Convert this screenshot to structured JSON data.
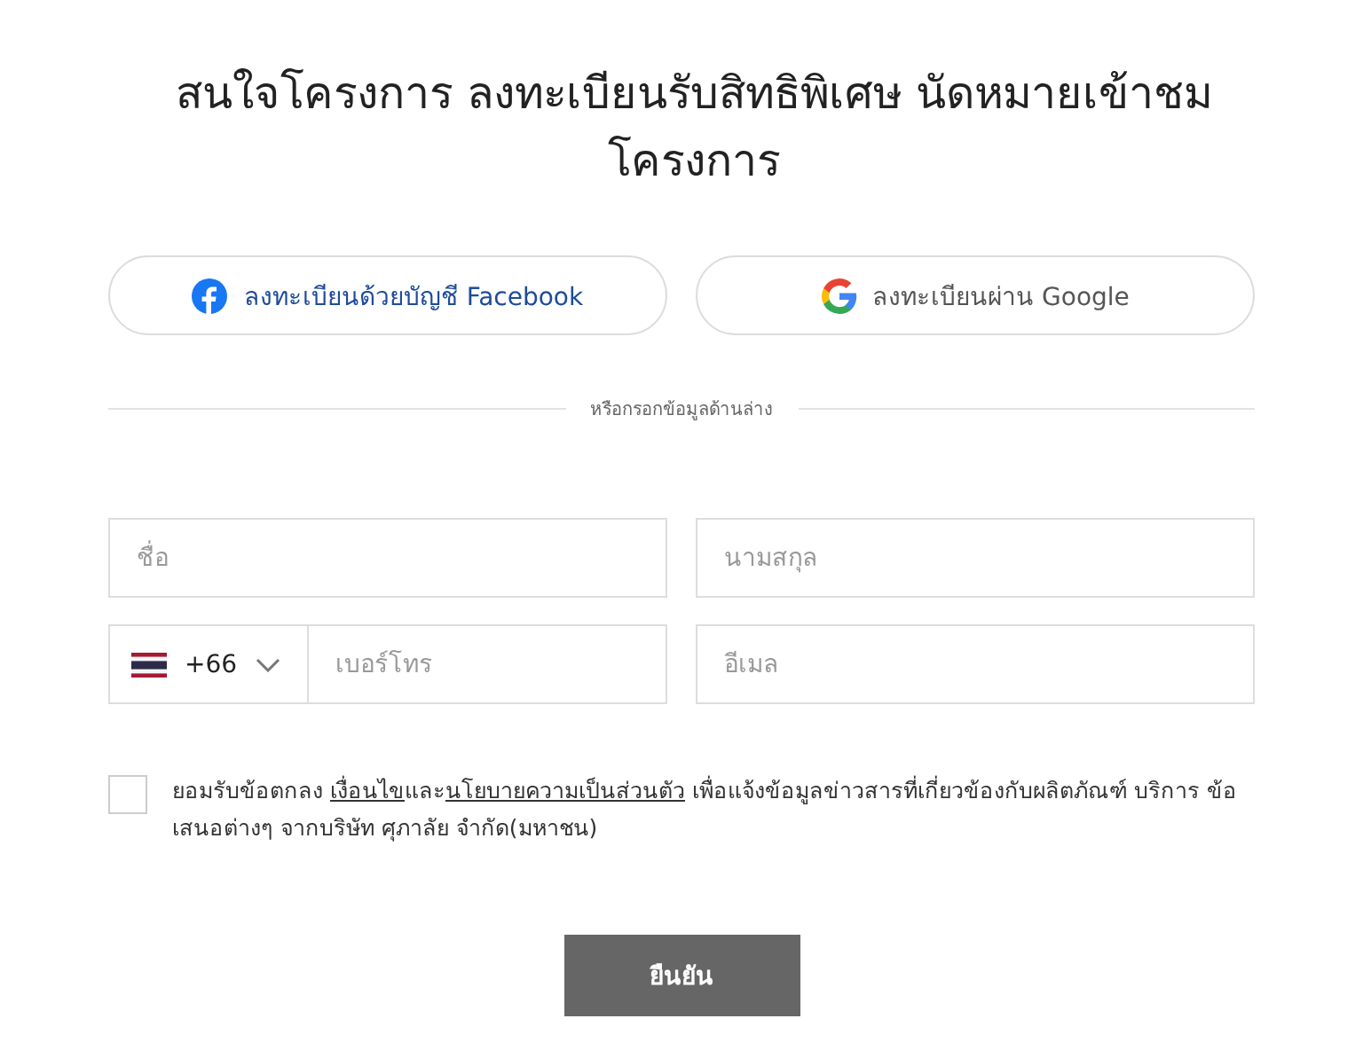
{
  "title": "สนใจโครงการ ลงทะเบียนรับสิทธิพิเศษ นัดหมายเข้าชมโครงการ",
  "social_buttons": [
    {
      "kind": "facebook",
      "label": "ลงทะเบียนด้วยบัญชี Facebook"
    },
    {
      "kind": "google",
      "label": "ลงทะเบียนผ่าน Google"
    }
  ],
  "divider_text": "หรือกรอกข้อมูลด้านล่าง",
  "fields": [
    {
      "kind": "text",
      "placeholder": "ชื่อ"
    },
    {
      "kind": "text",
      "placeholder": "นามสกุล"
    },
    {
      "kind": "phone",
      "country_code": "+66",
      "placeholder": "เบอร์โทร"
    },
    {
      "kind": "text",
      "placeholder": "อีเมล"
    }
  ],
  "consent": {
    "checked": false,
    "parts": [
      {
        "kind": "text",
        "text": "ยอมรับข้อตกลง "
      },
      {
        "kind": "link",
        "text": "เงื่อนไข"
      },
      {
        "kind": "text",
        "text": "และ"
      },
      {
        "kind": "link",
        "text": "นโยบายความเป็นส่วนตัว"
      },
      {
        "kind": "text",
        "text": " เพื่อแจ้งข้อมูลข่าวสารที่เกี่ยวข้องกับผลิตภัณฑ์ บริการ ข้อเสนอต่างๆ จากบริษัท ศุภาลัย จำกัด(มหาชน)"
      }
    ]
  },
  "submit": "ยืนยัน"
}
